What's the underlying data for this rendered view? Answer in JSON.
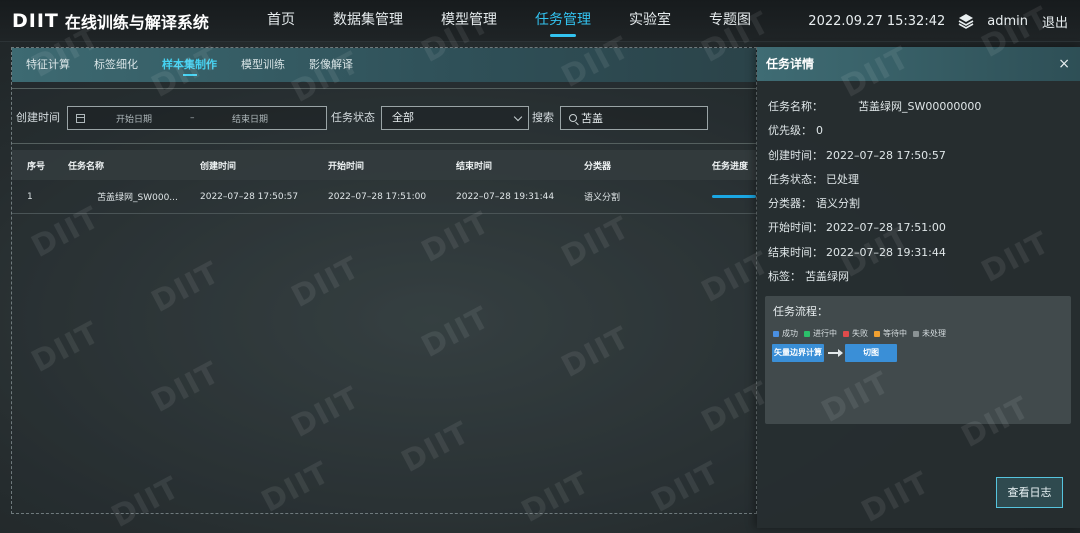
{
  "brand": {
    "logo": "DIIT",
    "title": "在线训练与解译系统"
  },
  "nav": {
    "items": [
      {
        "label": "首页",
        "active": false
      },
      {
        "label": "数据集管理",
        "active": false
      },
      {
        "label": "模型管理",
        "active": false
      },
      {
        "label": "任务管理",
        "active": true
      },
      {
        "label": "实验室",
        "active": false
      },
      {
        "label": "专题图",
        "active": false
      }
    ]
  },
  "header": {
    "datetime": "2022.09.27 15:32:42",
    "layers_icon": "layers-icon",
    "user": "admin",
    "logout": "退出"
  },
  "subtabs": [
    {
      "label": "特征计算",
      "active": false
    },
    {
      "label": "标签细化",
      "active": false
    },
    {
      "label": "样本集制作",
      "active": true
    },
    {
      "label": "模型训练",
      "active": false
    },
    {
      "label": "影像解译",
      "active": false
    }
  ],
  "filter": {
    "created_label": "创建时间",
    "start_placeholder": "开始日期",
    "range_sep": "–",
    "end_placeholder": "结束日期",
    "status_label": "任务状态",
    "status_value": "全部",
    "search_label": "搜索",
    "search_value": "苫盖"
  },
  "table": {
    "headers": [
      "序号",
      "任务名称",
      "创建时间",
      "开始时间",
      "结束时间",
      "分类器",
      "任务进度"
    ],
    "rows": [
      {
        "index": "1",
        "name": "苫盖绿网_SW000...",
        "created": "2022–07–28 17:50:57",
        "start": "2022–07–28 17:51:00",
        "end": "2022–07–28 19:31:44",
        "classifier": "语义分割",
        "progress": 1.0
      }
    ]
  },
  "detail": {
    "title": "任务详情",
    "close": "×",
    "fields": [
      {
        "key": "任务名称：",
        "value": "苫盖绿网_SW00000000"
      },
      {
        "key": "优先级：",
        "value": "0"
      },
      {
        "key": "创建时间：",
        "value": "2022–07–28 17:50:57"
      },
      {
        "key": "任务状态：",
        "value": "已处理"
      },
      {
        "key": "分类器：",
        "value": "语义分割"
      },
      {
        "key": "开始时间：",
        "value": "2022–07–28 17:51:00"
      },
      {
        "key": "结束时间：",
        "value": "2022–07–28 19:31:44"
      },
      {
        "key": "标签：",
        "value": "苫盖绿网"
      }
    ],
    "flow": {
      "title": "任务流程：",
      "legend": [
        {
          "label": "成功",
          "color": "#4a90e2"
        },
        {
          "label": "进行中",
          "color": "#2bbf6a"
        },
        {
          "label": "失败",
          "color": "#e04b4b"
        },
        {
          "label": "等待中",
          "color": "#f0a030"
        },
        {
          "label": "未处理",
          "color": "#8a9294"
        }
      ],
      "steps": [
        "矢量边界计算",
        "切图"
      ]
    },
    "log_button": "查看日志"
  },
  "watermark": "DIIT"
}
